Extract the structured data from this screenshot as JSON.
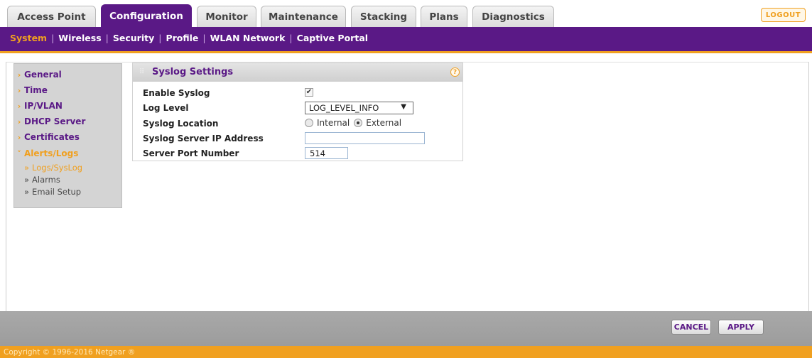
{
  "top_tabs": [
    {
      "label": "Access Point",
      "active": false
    },
    {
      "label": "Configuration",
      "active": true
    },
    {
      "label": "Monitor",
      "active": false
    },
    {
      "label": "Maintenance",
      "active": false
    },
    {
      "label": "Stacking",
      "active": false
    },
    {
      "label": "Plans",
      "active": false
    },
    {
      "label": "Diagnostics",
      "active": false
    }
  ],
  "logout_label": "LOGOUT",
  "sub_nav": [
    {
      "label": "System",
      "active": true
    },
    {
      "label": "Wireless",
      "active": false
    },
    {
      "label": "Security",
      "active": false
    },
    {
      "label": "Profile",
      "active": false
    },
    {
      "label": "WLAN Network",
      "active": false
    },
    {
      "label": "Captive Portal",
      "active": false
    }
  ],
  "left_menu": {
    "items": [
      {
        "label": "General"
      },
      {
        "label": "Time"
      },
      {
        "label": "IP/VLAN"
      },
      {
        "label": "DHCP Server"
      },
      {
        "label": "Certificates"
      },
      {
        "label": "Alerts/Logs",
        "expanded": true
      }
    ],
    "sub_items": [
      {
        "label": "Logs/SysLog",
        "active": true
      },
      {
        "label": "Alarms",
        "active": false
      },
      {
        "label": "Email Setup",
        "active": false
      }
    ]
  },
  "panel": {
    "title": "Syslog Settings",
    "help_glyph": "?",
    "fields": {
      "enable_syslog": {
        "label": "Enable Syslog",
        "checked": true
      },
      "log_level": {
        "label": "Log Level",
        "value": "LOG_LEVEL_INFO"
      },
      "syslog_location": {
        "label": "Syslog Location",
        "options": [
          "Internal",
          "External"
        ],
        "selected": "External"
      },
      "server_ip": {
        "label": "Syslog Server IP Address",
        "value": ""
      },
      "server_port": {
        "label": "Server Port Number",
        "value": "514"
      }
    }
  },
  "actions": {
    "cancel": "CANCEL",
    "apply": "APPLY"
  },
  "footer": "Copyright © 1996-2016 Netgear ®",
  "colors": {
    "brand_purple": "#5a1986",
    "accent_orange": "#f0a020"
  }
}
